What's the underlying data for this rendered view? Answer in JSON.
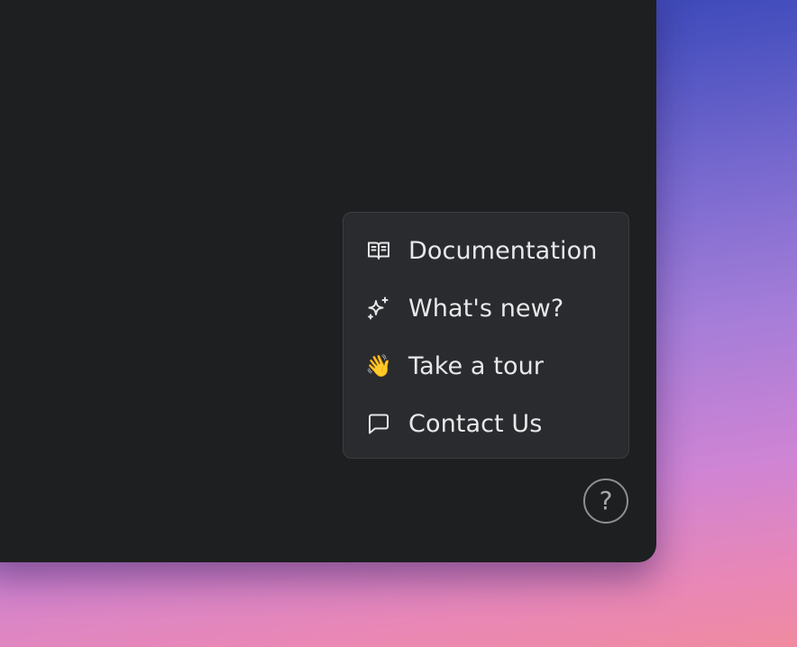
{
  "help_menu": {
    "items": [
      {
        "label": "Documentation",
        "icon": "book-open-icon"
      },
      {
        "label": "What's new?",
        "icon": "sparkles-icon"
      },
      {
        "label": "Take a tour",
        "icon": "waving-hand-icon",
        "emoji": "👋"
      },
      {
        "label": "Contact Us",
        "icon": "chat-bubble-icon"
      }
    ]
  },
  "help_button": {
    "glyph": "?",
    "icon": "question-mark-icon"
  },
  "colors": {
    "window_background": "#1e1f21",
    "menu_background": "#2a2b2e",
    "menu_border": "#3b3c40",
    "menu_text": "#e8e8ea",
    "help_button_border": "#8e8f94",
    "backdrop_top": "#283aa8",
    "backdrop_bottom": "#f08aa0"
  }
}
